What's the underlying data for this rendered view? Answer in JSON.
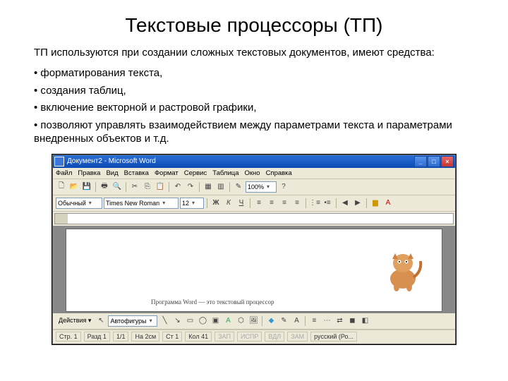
{
  "title": "Текстовые процессоры (ТП)",
  "intro": "ТП используются при создании сложных текстовых документов, имеют средства:",
  "bullets": [
    "• форматирования текста,",
    "• создания таблиц,",
    "• включение векторной и растровой графики,",
    "• позволяют управлять взаимодействием между параметрами текста и параметрами внедренных объектов и т.д."
  ],
  "app": {
    "title": "Документ2 - Microsoft Word",
    "menu": [
      "Файл",
      "Правка",
      "Вид",
      "Вставка",
      "Формат",
      "Сервис",
      "Таблица",
      "Окно",
      "Справка"
    ],
    "zoom": "100%",
    "style": "Обычный",
    "font": "Times New Roman",
    "size": "12",
    "doctext": "Программа Word — это текстовый процессор",
    "drawing_label": "Действия ▾",
    "autoshapes": "Автофигуры",
    "status": {
      "page": "Стр. 1",
      "sec": "Разд 1",
      "pages": "1/1",
      "at": "На 2см",
      "ln": "Ст 1",
      "col": "Кол 41",
      "rec": "ЗАП",
      "trk": "ИСПР",
      "ext": "ВДЛ",
      "ovr": "ЗАМ",
      "lang": "русский (Ро..."
    }
  }
}
